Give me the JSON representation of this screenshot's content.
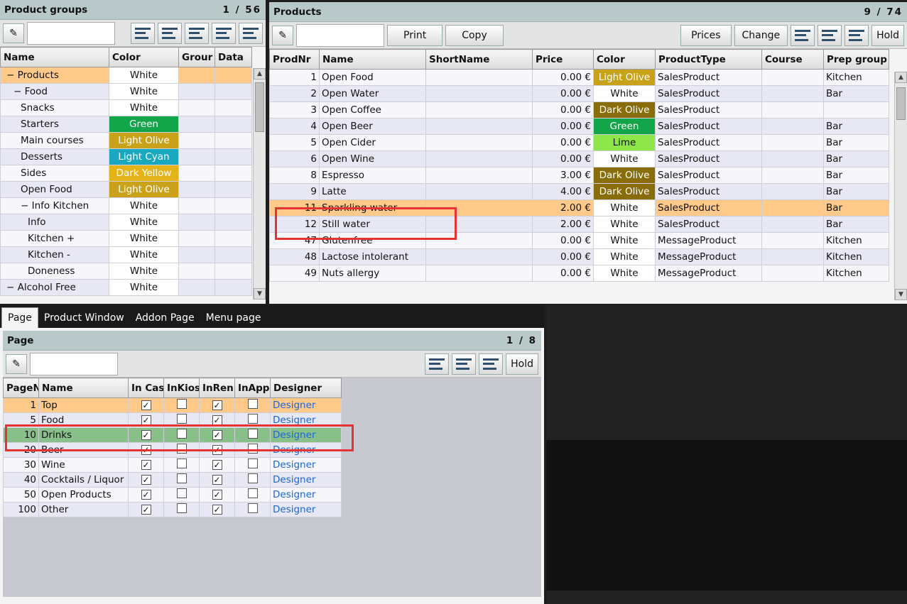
{
  "product_groups": {
    "title": "Product groups",
    "page_current": "1",
    "page_sep": "/",
    "page_total": "56",
    "columns": [
      "Name",
      "Color",
      "Grour",
      "Data"
    ],
    "rows": [
      {
        "name": "Products",
        "indent": 0,
        "prefix": "−",
        "color": "White"
      },
      {
        "name": "Food",
        "indent": 1,
        "prefix": "−",
        "color": "White"
      },
      {
        "name": "Snacks",
        "indent": 2,
        "prefix": "",
        "color": "White"
      },
      {
        "name": "Starters",
        "indent": 2,
        "prefix": "",
        "color": "Green"
      },
      {
        "name": "Main courses",
        "indent": 2,
        "prefix": "",
        "color": "Light Olive"
      },
      {
        "name": "Desserts",
        "indent": 2,
        "prefix": "",
        "color": "Light Cyan"
      },
      {
        "name": "Sides",
        "indent": 2,
        "prefix": "",
        "color": "Dark Yellow"
      },
      {
        "name": "Open Food",
        "indent": 2,
        "prefix": "",
        "color": "Light Olive"
      },
      {
        "name": "Info Kitchen",
        "indent": 2,
        "prefix": "−",
        "color": "White"
      },
      {
        "name": "Info",
        "indent": 3,
        "prefix": "",
        "color": "White"
      },
      {
        "name": "Kitchen +",
        "indent": 3,
        "prefix": "",
        "color": "White"
      },
      {
        "name": "Kitchen -",
        "indent": 3,
        "prefix": "",
        "color": "White"
      },
      {
        "name": "Doneness",
        "indent": 3,
        "prefix": "",
        "color": "White"
      },
      {
        "name": "Alcohol Free",
        "indent": 0,
        "prefix": "−",
        "color": "White"
      }
    ]
  },
  "products": {
    "title": "Products",
    "page_current": "9",
    "page_sep": "/",
    "page_total": "74",
    "buttons": {
      "print": "Print",
      "copy": "Copy",
      "prices": "Prices",
      "change": "Change",
      "hold": "Hold"
    },
    "columns": [
      "ProdNr",
      "Name",
      "ShortName",
      "Price",
      "Color",
      "ProductType",
      "Course",
      "Prep group"
    ],
    "rows": [
      {
        "nr": "1",
        "name": "Open Food",
        "short": "",
        "price": "0.00 €",
        "color": "Light Olive",
        "type": "SalesProduct",
        "course": "",
        "prep": "Kitchen"
      },
      {
        "nr": "2",
        "name": "Open Water",
        "short": "",
        "price": "0.00 €",
        "color": "White",
        "type": "SalesProduct",
        "course": "",
        "prep": "Bar"
      },
      {
        "nr": "3",
        "name": "Open Coffee",
        "short": "",
        "price": "0.00 €",
        "color": "Dark Olive",
        "type": "SalesProduct",
        "course": "",
        "prep": ""
      },
      {
        "nr": "4",
        "name": "Open Beer",
        "short": "",
        "price": "0.00 €",
        "color": "Green",
        "type": "SalesProduct",
        "course": "",
        "prep": "Bar"
      },
      {
        "nr": "5",
        "name": "Open Cider",
        "short": "",
        "price": "0.00 €",
        "color": "Lime",
        "type": "SalesProduct",
        "course": "",
        "prep": "Bar"
      },
      {
        "nr": "6",
        "name": "Open Wine",
        "short": "",
        "price": "0.00 €",
        "color": "White",
        "type": "SalesProduct",
        "course": "",
        "prep": "Bar"
      },
      {
        "nr": "8",
        "name": "Espresso",
        "short": "",
        "price": "3.00 €",
        "color": "Dark Olive",
        "type": "SalesProduct",
        "course": "",
        "prep": "Bar"
      },
      {
        "nr": "9",
        "name": "Latte",
        "short": "",
        "price": "4.00 €",
        "color": "Dark Olive",
        "type": "SalesProduct",
        "course": "",
        "prep": "Bar"
      },
      {
        "nr": "11",
        "name": "Sparkling water",
        "short": "",
        "price": "2.00 €",
        "color": "White",
        "type": "SalesProduct",
        "course": "",
        "prep": "Bar",
        "selected": true
      },
      {
        "nr": "12",
        "name": "Still water",
        "short": "",
        "price": "2.00 €",
        "color": "White",
        "type": "SalesProduct",
        "course": "",
        "prep": "Bar"
      },
      {
        "nr": "47",
        "name": "Glutenfree",
        "short": "",
        "price": "0.00 €",
        "color": "White",
        "type": "MessageProduct",
        "course": "",
        "prep": "Kitchen"
      },
      {
        "nr": "48",
        "name": "Lactose intolerant",
        "short": "",
        "price": "0.00 €",
        "color": "White",
        "type": "MessageProduct",
        "course": "",
        "prep": "Kitchen"
      },
      {
        "nr": "49",
        "name": "Nuts allergy",
        "short": "",
        "price": "0.00 €",
        "color": "White",
        "type": "MessageProduct",
        "course": "",
        "prep": "Kitchen"
      }
    ]
  },
  "tabs": [
    "Page",
    "Product Window",
    "Addon Page",
    "Menu page"
  ],
  "page_panel": {
    "title": "Page",
    "page_current": "1",
    "page_sep": "/",
    "page_total": "8",
    "hold_label": "Hold",
    "columns": [
      "PageN",
      "Name",
      "In Cas",
      "InKios",
      "InRen",
      "InApp",
      "Designer"
    ],
    "rows": [
      {
        "nr": "1",
        "name": "Top",
        "cas": true,
        "kios": false,
        "ren": true,
        "app": false,
        "designer": "Designer",
        "state": "selected"
      },
      {
        "nr": "5",
        "name": "Food",
        "cas": true,
        "kios": false,
        "ren": true,
        "app": false,
        "designer": "Designer",
        "state": ""
      },
      {
        "nr": "10",
        "name": "Drinks",
        "cas": true,
        "kios": false,
        "ren": true,
        "app": false,
        "designer": "Designer",
        "state": "green"
      },
      {
        "nr": "20",
        "name": "Beer",
        "cas": true,
        "kios": false,
        "ren": true,
        "app": false,
        "designer": "Designer",
        "state": ""
      },
      {
        "nr": "30",
        "name": "Wine",
        "cas": true,
        "kios": false,
        "ren": true,
        "app": false,
        "designer": "Designer",
        "state": ""
      },
      {
        "nr": "40",
        "name": "Cocktails / Liquor",
        "cas": true,
        "kios": false,
        "ren": true,
        "app": false,
        "designer": "Designer",
        "state": ""
      },
      {
        "nr": "50",
        "name": "Open Products",
        "cas": true,
        "kios": false,
        "ren": true,
        "app": false,
        "designer": "Designer",
        "state": ""
      },
      {
        "nr": "100",
        "name": "Other",
        "cas": true,
        "kios": false,
        "ren": true,
        "app": false,
        "designer": "Designer",
        "state": ""
      }
    ]
  },
  "color_map": {
    "White": {
      "bg": "#ffffff",
      "fg": "#111111"
    },
    "Green": {
      "bg": "#13a54a",
      "fg": "#ffffff"
    },
    "Light Olive": {
      "bg": "#c9a21a",
      "fg": "#ffffff"
    },
    "Light Cyan": {
      "bg": "#18a8c0",
      "fg": "#ffffff"
    },
    "Dark Yellow": {
      "bg": "#e4b318",
      "fg": "#ffffff"
    },
    "Dark Olive": {
      "bg": "#8a6d0b",
      "fg": "#ffffff"
    },
    "Lime": {
      "bg": "#8ee64a",
      "fg": "#111111"
    }
  },
  "icons": {
    "edit": "pencil-icon",
    "add": "add-list-icon",
    "modify": "edit-list-icon",
    "remove": "remove-list-icon"
  }
}
